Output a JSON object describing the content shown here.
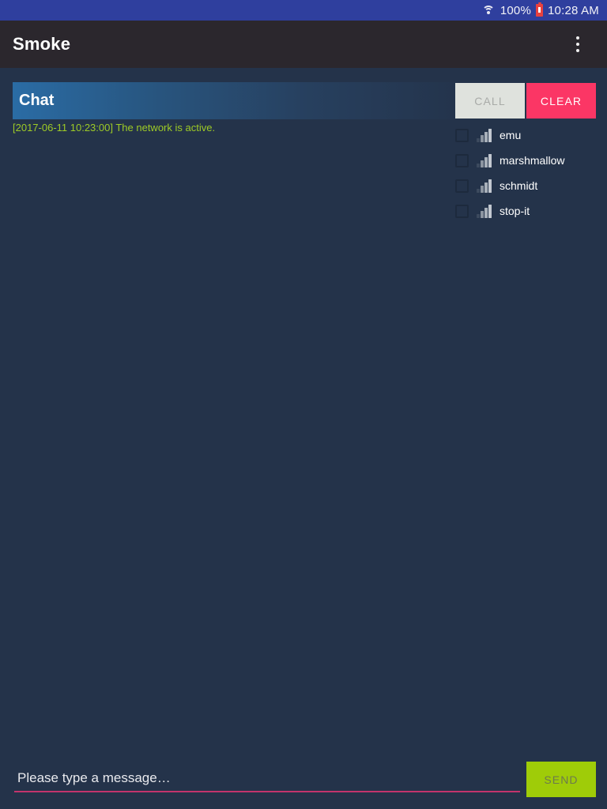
{
  "status_bar": {
    "wifi_icon": "wifi-icon",
    "battery_percent": "100%",
    "battery_icon": "battery-charging-icon",
    "time": "10:28 AM",
    "background_color": "#2f3f9e"
  },
  "app_bar": {
    "title": "Smoke",
    "overflow_icon": "more-vert-icon",
    "background_color": "#2b272d"
  },
  "chat_panel": {
    "header_title": "Chat",
    "header_gradient_start": "#2a6ca5",
    "header_gradient_end": "#24344c",
    "buttons": {
      "call_label": "CALL",
      "call_color": "#dfe2dd",
      "clear_label": "CLEAR",
      "clear_color": "#fb3665"
    },
    "log": [
      {
        "text": "[2017-06-11 10:23:00] The network is active.",
        "color": "#9ecb26"
      }
    ]
  },
  "participants": {
    "signal_icon": "signal-bars-icon",
    "checkbox_icon": "checkbox-unchecked-icon",
    "items": [
      {
        "name": "emu",
        "checked": false
      },
      {
        "name": "marshmallow",
        "checked": false
      },
      {
        "name": "schmidt",
        "checked": false
      },
      {
        "name": "stop-it",
        "checked": false
      }
    ]
  },
  "composer": {
    "input_value": "",
    "input_placeholder": "Please type a message…",
    "underline_color": "#c2346c",
    "send_label": "SEND",
    "send_color": "#9fcc08"
  },
  "theme": {
    "background_color": "#24334a"
  }
}
